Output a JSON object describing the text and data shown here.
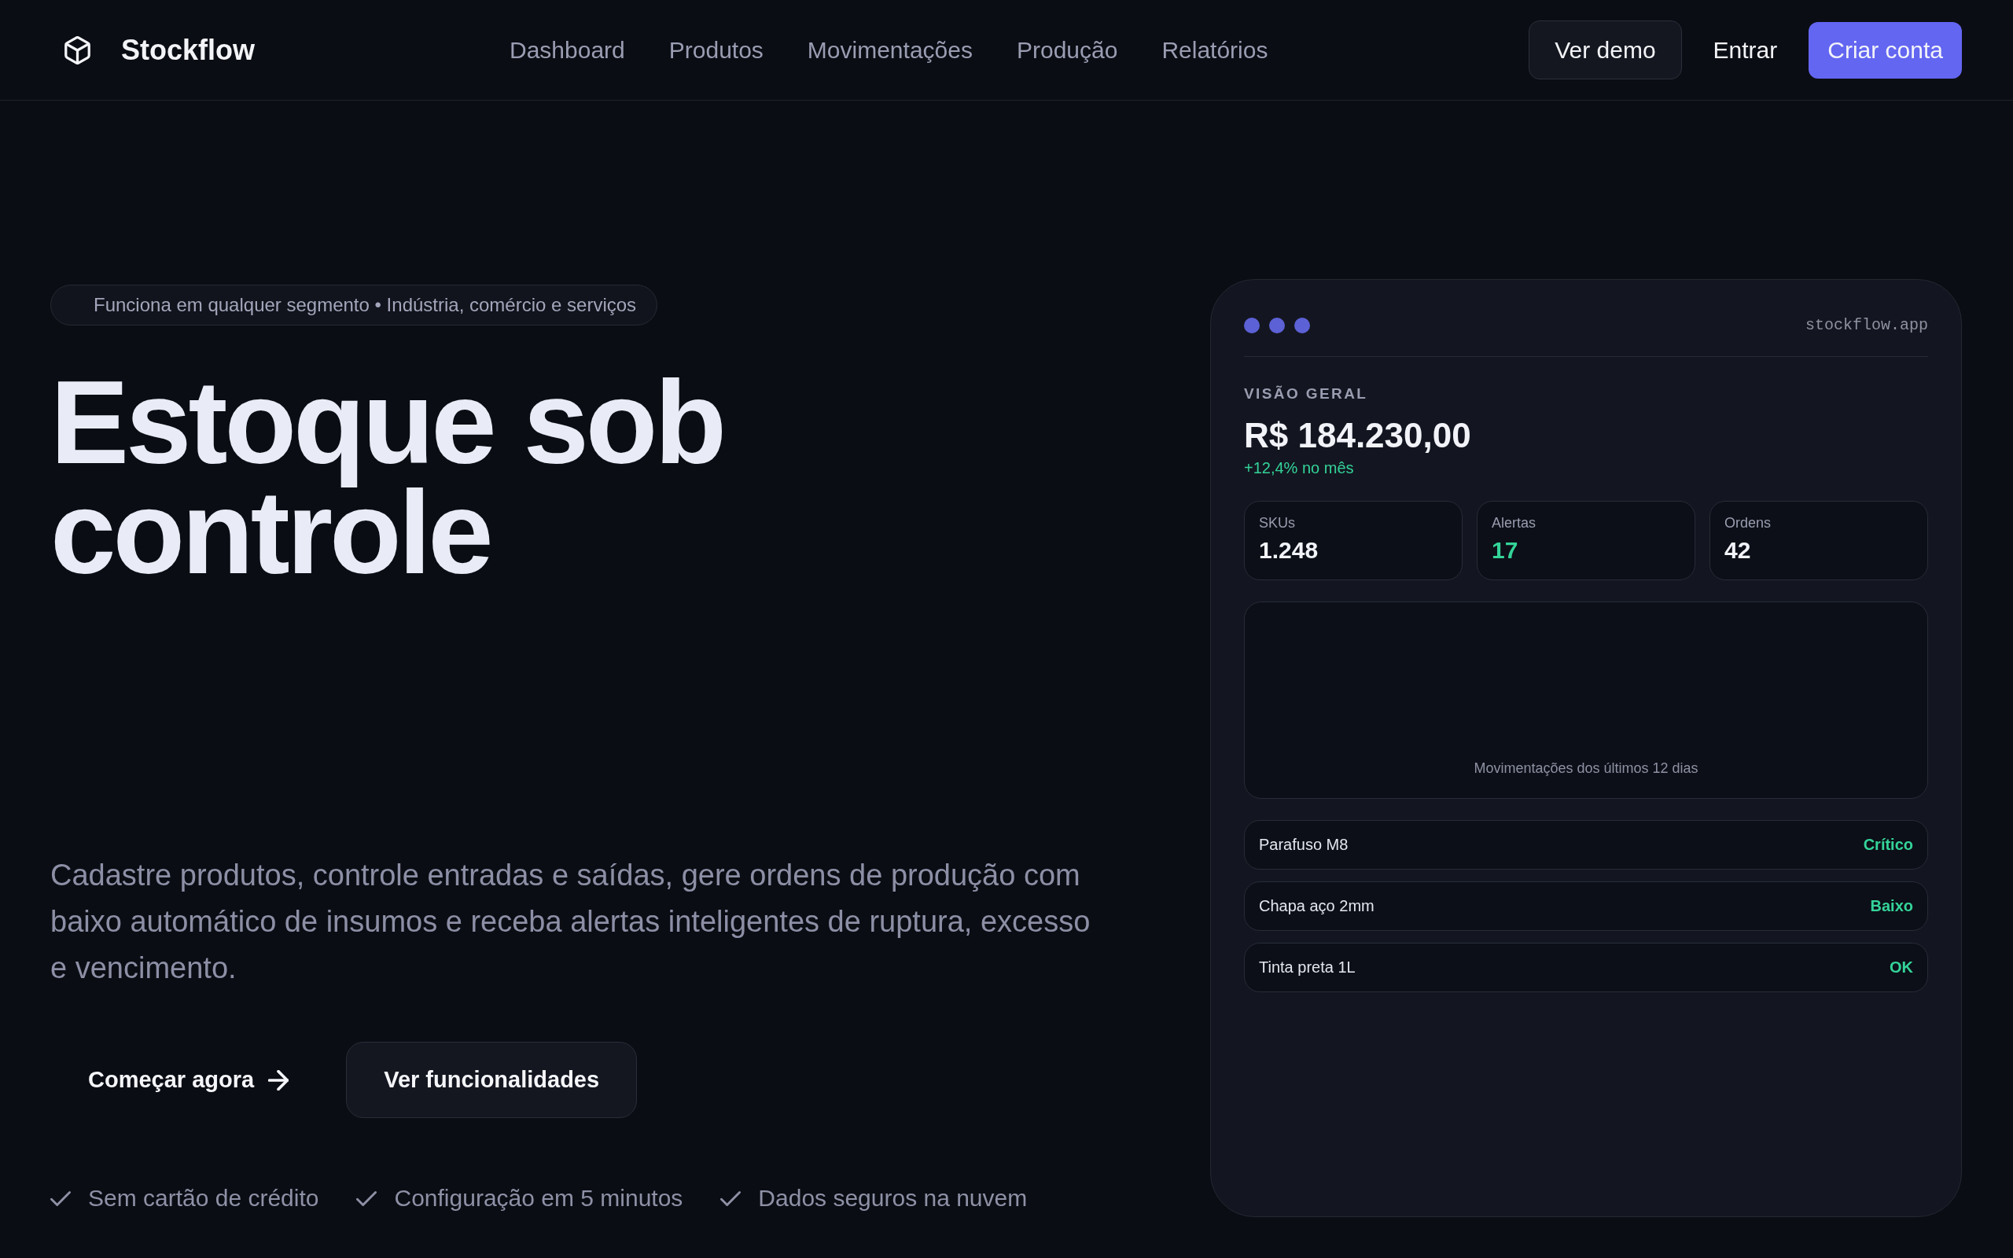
{
  "header": {
    "brand": "Stockflow",
    "nav_links": [
      "Dashboard",
      "Produtos",
      "Movimentações",
      "Produção",
      "Relatórios"
    ],
    "buttons": [
      {
        "label": "Ver demo",
        "kind": "outline"
      },
      {
        "label": "Entrar",
        "kind": "ghost"
      },
      {
        "label": "Criar conta",
        "kind": "primary"
      }
    ]
  },
  "hero": {
    "badge": "Funciona em qualquer segmento • Indústria, comércio e serviços",
    "title": "Estoque sob controle",
    "description": "Cadastre produtos, controle entradas e saídas, gere ordens de produção com baixo automático de insumos e receba alertas inteligentes de ruptura, excesso e vencimento.",
    "actions": [
      {
        "label": "Começar agora",
        "kind": "primary"
      },
      {
        "label": "Ver funcionalidades",
        "kind": "secondary"
      }
    ],
    "highlights": [
      "Sem cartão de crédito",
      "Configuração em 5 minutos",
      "Dados seguros na nuvem"
    ]
  },
  "preview": {
    "address": "stockflow.app",
    "section_label": "VISÃO GERAL",
    "total": "R$ 184.230,00",
    "change": "+12,4% no mês",
    "stats": [
      {
        "label": "SKUs",
        "value": "1.248",
        "color": "#f1f3f9"
      },
      {
        "label": "Alertas",
        "value": "17",
        "color": "#34d399"
      },
      {
        "label": "Ordens",
        "value": "42",
        "color": "#f1f3f9"
      }
    ],
    "chart_caption": "Movimentações dos últimos 12 dias",
    "items": [
      {
        "name": "Parafuso M8",
        "status": "Crítico"
      },
      {
        "name": "Chapa aço 2mm",
        "status": "Baixo"
      },
      {
        "name": "Tinta preta 1L",
        "status": "OK"
      }
    ]
  }
}
